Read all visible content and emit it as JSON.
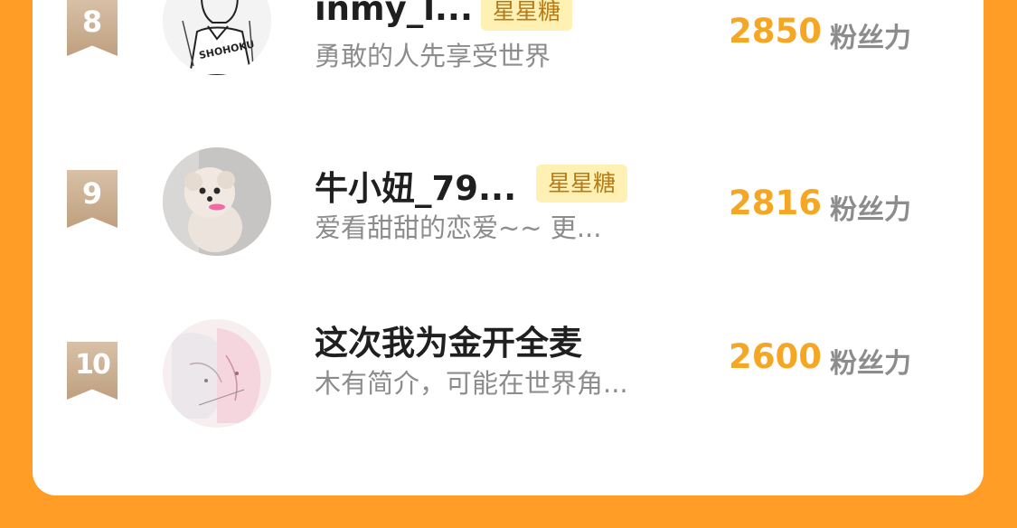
{
  "leaderboard": {
    "rows": [
      {
        "rank": "8",
        "name": "inmy_l...",
        "badge": "星星糖",
        "bio": "勇敢的人先享受世界",
        "score": "2850",
        "unit": "粉丝力",
        "avatar_icon": "sketch-portrait-avatar"
      },
      {
        "rank": "9",
        "name": "牛小妞_79...",
        "badge": "星星糖",
        "bio": "爱看甜甜的恋爱~~ 更...",
        "score": "2816",
        "unit": "粉丝力",
        "avatar_icon": "puppy-photo-avatar"
      },
      {
        "rank": "10",
        "name": "这次我为金开全麦",
        "bio": "木有简介，可能在世界角...",
        "score": "2600",
        "unit": "粉丝力",
        "avatar_icon": "anime-illustration-avatar"
      }
    ]
  },
  "colors": {
    "page_background": "#FF9D26",
    "card_background": "#FFFFFF",
    "score": "#F5A623",
    "badge_background": "#FFF0B3",
    "badge_text": "#B77A14",
    "rank_ribbon": "#C9AD8E"
  }
}
